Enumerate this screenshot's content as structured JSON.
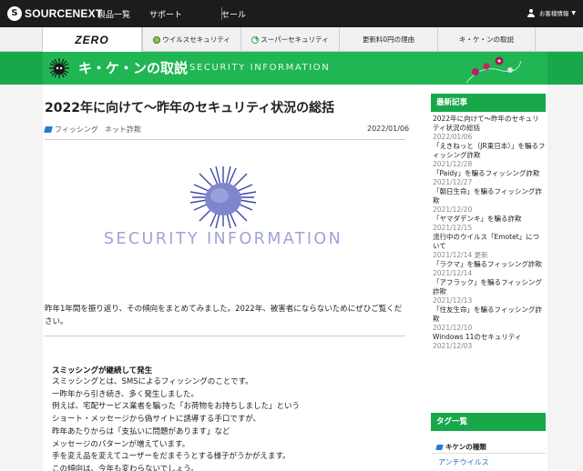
{
  "topbar": {
    "logo_text": "SOURCENEXT",
    "nav": [
      "製品一覧",
      "サポート",
      "セール"
    ],
    "account_label": "お客様情報"
  },
  "tabs": {
    "zero_label": "ZERO",
    "items": [
      "ウイルスセキュリティ",
      "スーパーセキュリティ",
      "更新料0円の理由",
      "キ・ケ・ンの取説"
    ]
  },
  "banner": {
    "title": "キ・ケ・ンの取説",
    "subtitle": "SECURITY INFORMATION"
  },
  "article": {
    "title": "2022年に向けて〜昨年のセキュリティ状況の総括",
    "tags": [
      "フィッシング",
      "ネット詐欺"
    ],
    "date": "2022/01/06",
    "hero_text": "SECURITY INFORMATION",
    "intro": "昨年1年間を振り返り、その傾向をまとめてみました。2022年、被害者にならないためにぜひご覧ください。",
    "section_heading": "スミッシングが継続して発生",
    "body": [
      "スミッシングとは、SMSによるフィッシングのことです。",
      "一昨年から引き続き、多く発生しました。",
      "例えば、宅配サービス業者を騙った「お荷物をお持ちしました」という",
      "ショート・メッセージから偽サイトに誘導する手口ですが、",
      "昨年あたりからは「支払いに問題があります」など",
      "メッセージのパターンが増えています。",
      "手を変え品を変えてユーザーをだまそうとする様子がうかがえます。",
      "この傾向は、今年も変わらないでしょう。"
    ]
  },
  "sidebar": {
    "recent_heading": "最新記事",
    "recent": [
      {
        "title": "2022年に向けて〜昨年のセキュリティ状況の総括",
        "date": "2022/01/06"
      },
      {
        "title": "「えきねっと（JR東日本）」を騙るフィッシング詐欺",
        "date": "2021/12/28"
      },
      {
        "title": "「Paidy」を騙るフィッシング詐欺",
        "date": "2021/12/27"
      },
      {
        "title": "「朝日生命」を騙るフィッシング詐欺",
        "date": "2021/12/20"
      },
      {
        "title": "「ヤマダデンキ」を騙る詐欺",
        "date": "2021/12/15"
      },
      {
        "title": "流行中のウイルス「Emotet」について",
        "date": "2021/12/14 更新"
      },
      {
        "title": "「ラクマ」を騙るフィッシング詐欺",
        "date": "2021/12/14"
      },
      {
        "title": "「アフラック」を騙るフィッシング詐欺",
        "date": "2021/12/13"
      },
      {
        "title": "「住友生命」を騙るフィッシング詐欺",
        "date": "2021/12/10"
      },
      {
        "title": "Windows 11のセキュリティ",
        "date": "2021/12/03"
      }
    ],
    "tag_heading": "タグ一覧",
    "category_heading": "キケンの種類",
    "category_link": "アンチウイルス"
  },
  "colors": {
    "brand_green": "#1fb653",
    "topbar": "#1c1c1c",
    "hero_purple": "#9fa3d7",
    "link_blue": "#2a6fc0"
  }
}
